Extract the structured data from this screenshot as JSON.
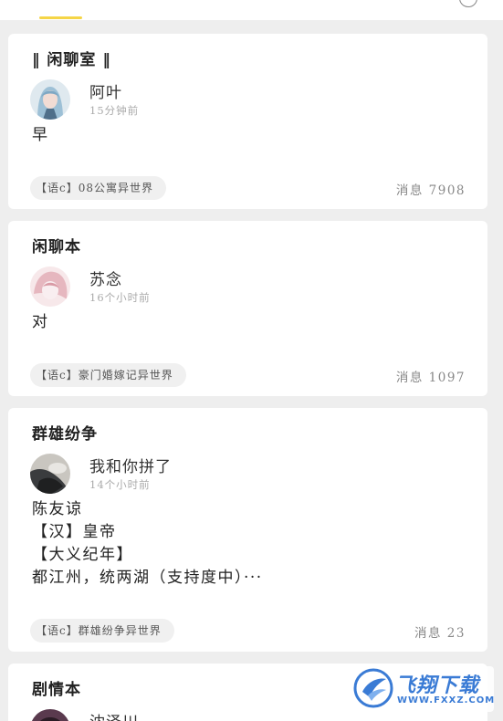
{
  "posts": [
    {
      "title": "‖ 闲聊室 ‖",
      "user": "阿叶",
      "time": "15分钟前",
      "content": [
        "早"
      ],
      "tag": "【语c】08公寓异世界",
      "messages": "消息 7908",
      "avatar_colors": [
        "#cfe3ef",
        "#7fa8c4",
        "#e9d2cc"
      ]
    },
    {
      "title": "闲聊本",
      "user": "苏念",
      "time": "16个小时前",
      "content": [
        "对"
      ],
      "tag": "【语c】豪门婚嫁记异世界",
      "messages": "消息 1097",
      "avatar_colors": [
        "#f3d8dc",
        "#e6b7bf",
        "#f9eef0"
      ]
    },
    {
      "title": "群雄纷争",
      "user": "我和你拼了",
      "time": "14个小时前",
      "content": [
        "陈友谅",
        "【汉】皇帝",
        "【大义纪年】",
        "都江州，统两湖（支持度中）···"
      ],
      "tag": "【语c】群雄纷争异世界",
      "messages": "消息 23",
      "avatar_colors": [
        "#6b6e70",
        "#2f3133",
        "#c9c6c0"
      ]
    },
    {
      "title": "剧情本",
      "user": "沈泽川",
      "avatar_colors": [
        "#5a3a4e",
        "#2a1c25",
        "#8e6b80"
      ]
    }
  ],
  "watermark": {
    "text": "飞翔下载",
    "url": "WWW.FXXZ.COM"
  },
  "colors": {
    "accent": "#f5d547",
    "background": "#eeeeee",
    "card": "#ffffff"
  }
}
